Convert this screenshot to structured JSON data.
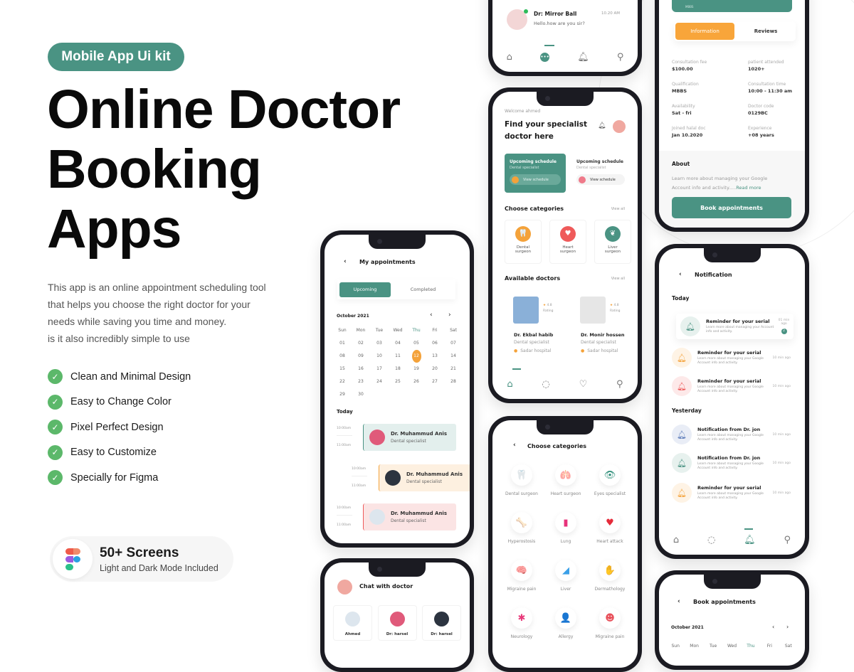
{
  "promo": {
    "badge": "Mobile App Ui kit",
    "title_lines": [
      "Online Doctor",
      "Booking",
      "Apps"
    ],
    "description_lines": [
      "This app is an online appointment scheduling tool",
      "that helps you choose the right doctor for your",
      "needs while saving you time and money.",
      "is it also incredibly simple to use"
    ],
    "features": [
      "Clean and Minimal Design",
      "Easy to Change Color",
      "Pixel Perfect Design",
      "Easy to Customize",
      "Specially for Figma"
    ],
    "screens_title": "50+ Screens",
    "screens_subtitle": "Light and Dark Mode Included",
    "colors": {
      "primary": "#4a9383",
      "accent": "#f4a23a",
      "check": "#5cb86a"
    }
  },
  "chat_list_phone": {
    "name": "Dr: Mirror Ball",
    "time": "10.20 AM",
    "message": "Hello.how are you sir?"
  },
  "doctor_detail_phone": {
    "header_sub": "MBBS",
    "tabs": [
      "Information",
      "Reviews"
    ],
    "fields": [
      {
        "label": "Consultation fee",
        "value": "$100.00"
      },
      {
        "label": "patient attended",
        "value": "1020+"
      },
      {
        "label": "Qualification",
        "value": "MBBS"
      },
      {
        "label": "Consultation time",
        "value": "10:00 - 11:30 am"
      },
      {
        "label": "Availability",
        "value": "Sat - fri"
      },
      {
        "label": "Doctor code",
        "value": "0129BC"
      },
      {
        "label": "Joined halal doc",
        "value": "Jan 10.2020"
      },
      {
        "label": "Experience",
        "value": "+08 years"
      }
    ],
    "about_title": "About",
    "about_text": "Learn more about managing your Google Account info and activity.....",
    "read_more": "Read more",
    "book_button": "Book appointments"
  },
  "home_phone": {
    "welcome": "Welcome ahmed",
    "title_line1": "Find your specialist",
    "title_line2": "doctor here",
    "schedules": [
      {
        "title": "Upcoming schedule",
        "sub": "Dental specialist",
        "button": "View schedule"
      },
      {
        "title": "Upcoming schedule",
        "sub": "Dental specialist",
        "button": "View schedule"
      }
    ],
    "categories_title": "Choose categories",
    "view_all": "View all",
    "categories": [
      {
        "line1": "Dental",
        "line2": "surgeon",
        "color": "#f4a23a",
        "icon": "tooth-icon"
      },
      {
        "line1": "Heart",
        "line2": "surgeon",
        "color": "#ef5a5a",
        "icon": "heart-icon"
      },
      {
        "line1": "Liver",
        "line2": "surgeon",
        "color": "#4a9383",
        "icon": "lungs-icon"
      }
    ],
    "doctors_title": "Available doctors",
    "doctors": [
      {
        "name": "Dr. Ekbal habib",
        "spec": "Dental specialist",
        "hospital": "Sadar hospital",
        "rating": "4.8",
        "rating_label": "Rating"
      },
      {
        "name": "Dr. Monir hossen",
        "spec": "Dental specialist",
        "hospital": "Sadar hospital",
        "rating": "4.8",
        "rating_label": "Rating"
      }
    ]
  },
  "appointments_phone": {
    "title": "My appointments",
    "tabs": [
      "Upcoming",
      "Completed"
    ],
    "month": "October 2021",
    "weekdays": [
      "Sun",
      "Mon",
      "Tue",
      "Wed",
      "Thu",
      "Fri",
      "Sat"
    ],
    "days": [
      "01",
      "02",
      "03",
      "04",
      "05",
      "06",
      "07",
      "08",
      "09",
      "10",
      "11",
      "12",
      "13",
      "14",
      "15",
      "16",
      "17",
      "18",
      "19",
      "20",
      "21",
      "22",
      "23",
      "24",
      "25",
      "26",
      "27",
      "28",
      "29",
      "30"
    ],
    "selected_day": "12",
    "today_label": "Today",
    "appointments": [
      {
        "start": "10:00am",
        "end": "11:00am",
        "name": "Dr. Muhammud Anis",
        "spec": "Dental specialist",
        "bg": "#e3efed",
        "bar": "#4a9383"
      },
      {
        "start": "10:00am",
        "end": "11:00am",
        "name": "Dr. Muhammud Anis",
        "spec": "Dental specialist",
        "bg": "#fdf0e0",
        "bar": "#f4a23a"
      },
      {
        "start": "10:00am",
        "end": "11:00am",
        "name": "Dr. Muhammud Anis",
        "spec": "Dental specialist",
        "bg": "#fbe4e4",
        "bar": "#ef5a5a"
      }
    ]
  },
  "categories_phone": {
    "title": "Choose categories",
    "items": [
      {
        "label": "Dental surgeon",
        "glyph": "🦷",
        "color": "#2a5bd7"
      },
      {
        "label": "Heart surgeon",
        "glyph": "🫁",
        "color": "#e0605a"
      },
      {
        "label": "Eyes specialist",
        "glyph": "👁",
        "color": "#2f8f7a"
      },
      {
        "label": "Hyperostosis",
        "glyph": "🦴",
        "color": "#f06a3a"
      },
      {
        "label": "Lung",
        "glyph": "▮",
        "color": "#e8327a"
      },
      {
        "label": "Heart attack",
        "glyph": "♥",
        "color": "#e52b3a"
      },
      {
        "label": "Migraine pain",
        "glyph": "🧠",
        "color": "#f4a23a"
      },
      {
        "label": "Liver",
        "glyph": "◢",
        "color": "#3aa0e8"
      },
      {
        "label": "Dermathology",
        "glyph": "✋",
        "color": "#e8a07a"
      },
      {
        "label": "Neurology",
        "glyph": "✱",
        "color": "#e83a7a"
      },
      {
        "label": "Allergy",
        "glyph": "👤",
        "color": "#e87a3a"
      },
      {
        "label": "Migraine pain",
        "glyph": "☻",
        "color": "#e8505a"
      }
    ]
  },
  "notification_phone": {
    "title": "Notification",
    "today_label": "Today",
    "today": [
      {
        "title": "Reminder for your serial",
        "desc": "Learn more about managing your Account info and activity.",
        "time": "01 min ago",
        "badge": "2",
        "color": "#4a9383"
      },
      {
        "title": "Reminder for your serial",
        "desc": "Learn more about managing your Google Account info and activity.",
        "time": "10 min ago",
        "color": "#f4a23a"
      },
      {
        "title": "Reminder for your serial",
        "desc": "Learn more about managing your Google Account info and activity.",
        "time": "10 min ago",
        "color": "#ef5a5a"
      }
    ],
    "yesterday_label": "Yesterday",
    "yesterday": [
      {
        "title": "Notification from Dr. jon",
        "desc": "Learn more about managing your Google Account info and activity.",
        "time": "10 min ago",
        "color": "#5a7ab8"
      },
      {
        "title": "Notification from Dr. jon",
        "desc": "Learn more about managing your Google Account info and activity.",
        "time": "10 min ago",
        "color": "#4a9383"
      },
      {
        "title": "Reminder for your serial",
        "desc": "Learn more about managing your Google Account info and activity.",
        "time": "10 min ago",
        "color": "#f4a23a"
      }
    ]
  },
  "chat_phone": {
    "title": "Chat with doctor",
    "contacts": [
      "Ahmed",
      "Dr: harsel",
      "Dr: harsel"
    ]
  },
  "book_phone": {
    "title": "Book appointments",
    "month": "October 2021",
    "weekdays": [
      "Sun",
      "Mon",
      "Tue",
      "Wed",
      "Thu",
      "Fri",
      "Sat"
    ]
  }
}
